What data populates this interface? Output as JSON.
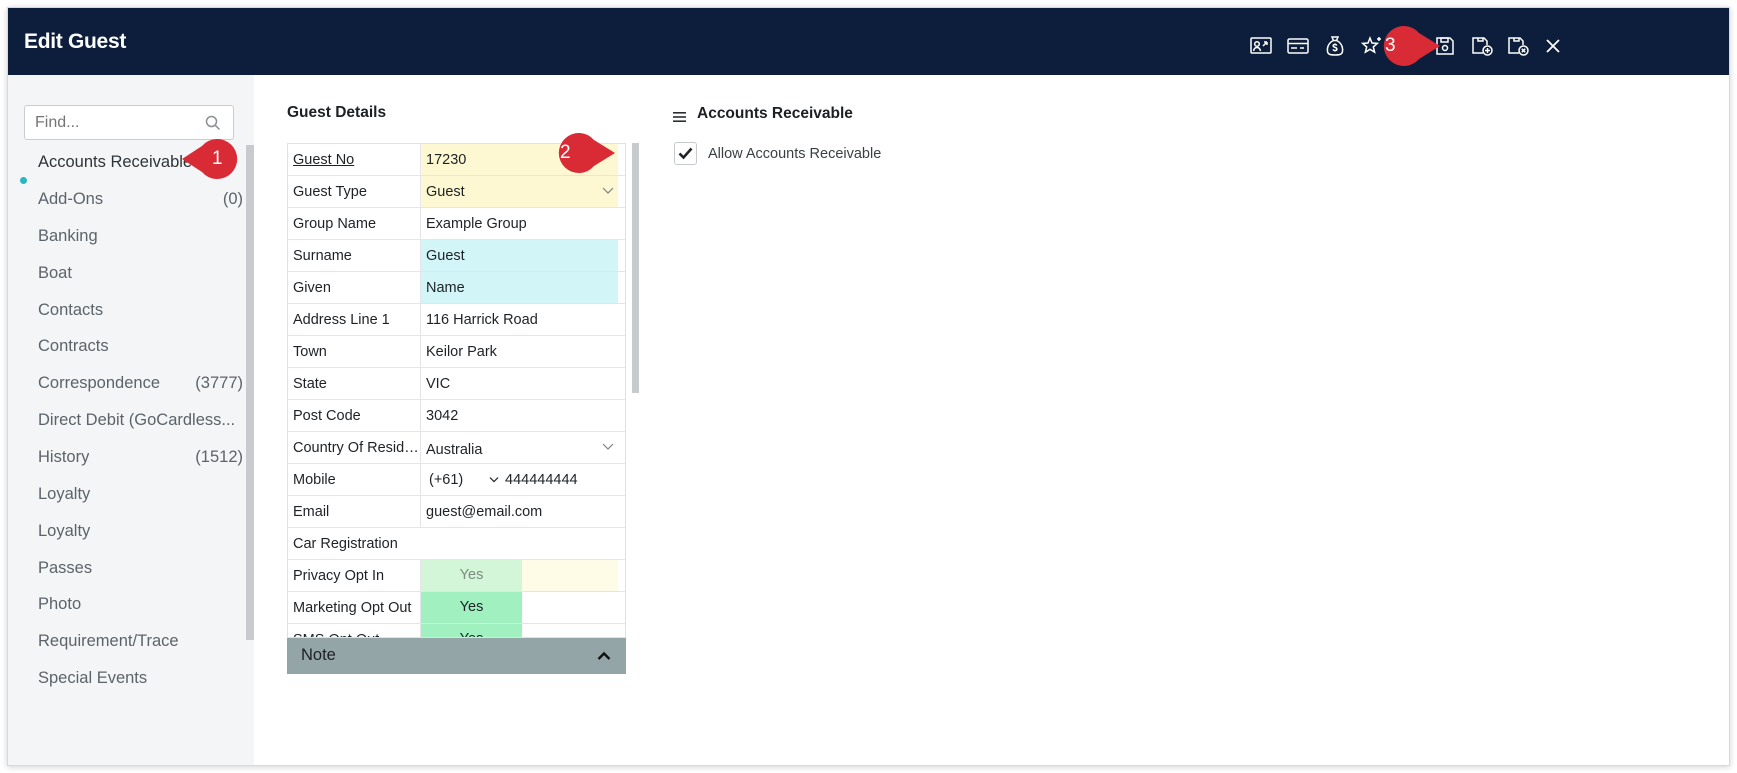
{
  "window": {
    "title": "Edit Guest"
  },
  "toolbar": {
    "buttons": [
      {
        "icon": "guest-portal-icon"
      },
      {
        "icon": "card-icon"
      },
      {
        "icon": "money-bag-icon"
      },
      {
        "icon": "loyalty-star-icon"
      },
      {
        "icon": "save-icon"
      },
      {
        "icon": "save-and-new-icon"
      },
      {
        "icon": "save-and-close-icon"
      },
      {
        "icon": "close-icon"
      }
    ]
  },
  "sidebar": {
    "search_placeholder": "Find...",
    "items": [
      {
        "label": "Accounts Receivable",
        "count": ""
      },
      {
        "label": "Add-Ons",
        "count": "(0)"
      },
      {
        "label": "Banking",
        "count": ""
      },
      {
        "label": "Boat",
        "count": ""
      },
      {
        "label": "Contacts",
        "count": ""
      },
      {
        "label": "Contracts",
        "count": ""
      },
      {
        "label": "Correspondence",
        "count": "(3777)"
      },
      {
        "label": "Direct Debit (GoCardless...",
        "count": ""
      },
      {
        "label": "History",
        "count": "(1512)"
      },
      {
        "label": "Loyalty",
        "count": ""
      },
      {
        "label": "Loyalty",
        "count": ""
      },
      {
        "label": "Passes",
        "count": ""
      },
      {
        "label": "Photo",
        "count": ""
      },
      {
        "label": "Requirement/Trace",
        "count": ""
      },
      {
        "label": "Special Events",
        "count": ""
      }
    ]
  },
  "guest_details": {
    "title": "Guest Details",
    "rows": [
      {
        "label": "Guest No",
        "value": "17230"
      },
      {
        "label": "Guest Type",
        "value": "Guest"
      },
      {
        "label": "Group Name",
        "value": "Example Group"
      },
      {
        "label": "Surname",
        "value": "Guest"
      },
      {
        "label": "Given",
        "value": "Name"
      },
      {
        "label": "Address Line 1",
        "value": "116 Harrick Road"
      },
      {
        "label": "Town",
        "value": "Keilor Park"
      },
      {
        "label": "State",
        "value": "VIC"
      },
      {
        "label": "Post Code",
        "value": "3042"
      },
      {
        "label": "Country Of Reside...",
        "value": "Australia"
      },
      {
        "label": "Mobile",
        "prefix": "(+61)",
        "value": "444444444"
      },
      {
        "label": "Email",
        "value": "guest@email.com"
      },
      {
        "label": "Car Registration",
        "value": ""
      },
      {
        "label": "Privacy Opt In",
        "value": "Yes"
      },
      {
        "label": "Marketing Opt Out",
        "value": "Yes"
      },
      {
        "label": "SMS Opt Out",
        "value": "Yes"
      }
    ],
    "note_label": "Note"
  },
  "accounts_receivable": {
    "title": "Accounts Receivable",
    "allow_label": "Allow Accounts Receivable",
    "allow_checked": true
  },
  "callouts": [
    "1",
    "2",
    "3"
  ],
  "colors": {
    "header_bg": "#0c1e3b",
    "callout_red": "#d92b35",
    "active_dot": "#29b6c4",
    "mandatory_yellow": "#fdf8d1",
    "name_cyan": "#d2f6f8",
    "opt_green": "#a0f0c0"
  }
}
